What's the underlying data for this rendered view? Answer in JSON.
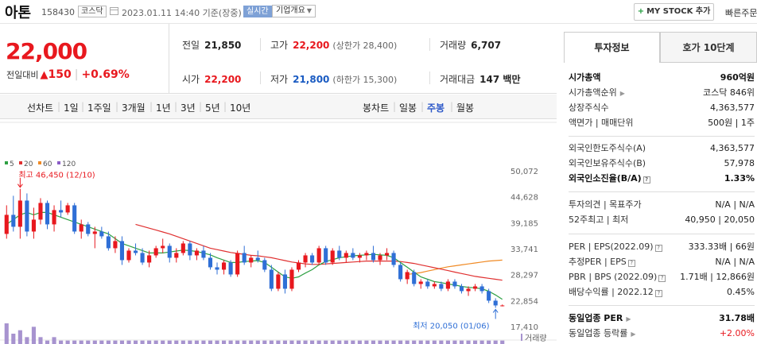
{
  "header": {
    "name": "아톤",
    "code": "158430",
    "market": "코스닥",
    "datetime": "2023.01.11 14:40 기준(장중)",
    "live_badge": "실시간",
    "overview_label": "기업개요",
    "mystock_label": "MY STOCK 추가",
    "quick_order_label": "빠른주문"
  },
  "price": {
    "current": "22,000",
    "prev_label": "전일대비",
    "change": "150",
    "change_pct": "+0.69%",
    "color_up": "#e8181e",
    "color_down": "#1a5bc2"
  },
  "stats": {
    "prev_close_label": "전일",
    "prev_close": "21,850",
    "high_label": "고가",
    "high": "22,200",
    "upper_limit_label": "(상한가 28,400)",
    "volume_label": "거래량",
    "volume": "6,707",
    "open_label": "시가",
    "open": "22,200",
    "low_label": "저가",
    "low": "21,800",
    "lower_limit_label": "(하한가 15,300)",
    "amount_label": "거래대금",
    "amount": "147 백만"
  },
  "periods": {
    "line_chart": "선차트",
    "items": [
      "1일",
      "1주일",
      "3개월",
      "1년",
      "3년",
      "5년",
      "10년"
    ],
    "candle_chart": "봉차트",
    "candle_items": [
      "일봉",
      "주봉",
      "월봉"
    ],
    "selected_candle": "주봉"
  },
  "chart_data": {
    "type": "candlestick",
    "legend": [
      {
        "name": "5",
        "color": "#2ea043"
      },
      {
        "name": "20",
        "color": "#e03030"
      },
      {
        "name": "60",
        "color": "#f08a24"
      },
      {
        "name": "120",
        "color": "#8a5cc6"
      }
    ],
    "y_ticks": [
      "50,072",
      "44,628",
      "39,185",
      "33,741",
      "28,297",
      "22,854",
      "17,410"
    ],
    "ylim": [
      17410,
      50072
    ],
    "annotations": {
      "high": "최고 46,450 (12/10)",
      "low": "최저 20,050 (01/06)"
    },
    "volume_label": "거래량",
    "candles": [
      [
        37000,
        43000,
        36000,
        41000
      ],
      [
        41000,
        45000,
        37500,
        38500
      ],
      [
        38500,
        46450,
        36000,
        44000
      ],
      [
        44000,
        45500,
        36500,
        37500
      ],
      [
        37500,
        42500,
        36000,
        40000
      ],
      [
        40000,
        44500,
        39000,
        43500
      ],
      [
        43500,
        44000,
        38000,
        39000
      ],
      [
        39000,
        43000,
        37500,
        42000
      ],
      [
        42000,
        44000,
        40500,
        41500
      ],
      [
        41500,
        43500,
        41000,
        43000
      ],
      [
        43000,
        43500,
        37000,
        37500
      ],
      [
        37500,
        40000,
        36000,
        39000
      ],
      [
        39000,
        39500,
        36500,
        37000
      ],
      [
        37000,
        38500,
        34000,
        37500
      ],
      [
        37500,
        38500,
        36000,
        36500
      ],
      [
        36500,
        37500,
        33500,
        34000
      ],
      [
        34000,
        36500,
        33000,
        35500
      ],
      [
        35500,
        36500,
        30500,
        31500
      ],
      [
        31500,
        34000,
        31000,
        33500
      ],
      [
        33500,
        35000,
        32500,
        33000
      ],
      [
        33000,
        34000,
        30500,
        31000
      ],
      [
        31000,
        33500,
        30000,
        32500
      ],
      [
        32500,
        34500,
        32000,
        34000
      ],
      [
        34000,
        36000,
        33000,
        34500
      ],
      [
        34500,
        35000,
        31000,
        32000
      ],
      [
        32000,
        34000,
        31000,
        33000
      ],
      [
        33000,
        35500,
        32500,
        35000
      ],
      [
        35000,
        35500,
        31500,
        32500
      ],
      [
        32500,
        34000,
        31500,
        33500
      ],
      [
        33500,
        34500,
        31500,
        32000
      ],
      [
        32000,
        33000,
        29500,
        30000
      ],
      [
        30000,
        31000,
        28500,
        29500
      ],
      [
        29500,
        31500,
        28500,
        31000
      ],
      [
        31000,
        31500,
        28000,
        28500
      ],
      [
        28500,
        33500,
        28000,
        33000
      ],
      [
        33000,
        34500,
        30500,
        31000
      ],
      [
        31000,
        32500,
        30000,
        32000
      ],
      [
        32000,
        33500,
        31000,
        31500
      ],
      [
        31500,
        32000,
        29000,
        29500
      ],
      [
        29500,
        30500,
        25000,
        25500
      ],
      [
        25500,
        29000,
        25000,
        28500
      ],
      [
        28500,
        29500,
        24500,
        25500
      ],
      [
        25500,
        30000,
        25000,
        29500
      ],
      [
        29500,
        31500,
        29000,
        31000
      ],
      [
        31000,
        33000,
        30000,
        32500
      ],
      [
        32500,
        33000,
        30500,
        31000
      ],
      [
        31000,
        34500,
        30500,
        34000
      ],
      [
        34000,
        34500,
        30500,
        31000
      ],
      [
        31000,
        34000,
        30500,
        33500
      ],
      [
        33500,
        34500,
        31500,
        32000
      ],
      [
        32000,
        33500,
        31000,
        33000
      ],
      [
        33000,
        34000,
        31500,
        32000
      ],
      [
        32000,
        33000,
        31000,
        32500
      ],
      [
        32500,
        33500,
        31500,
        33000
      ],
      [
        33000,
        34500,
        31000,
        31500
      ],
      [
        31500,
        33000,
        30500,
        32500
      ],
      [
        32500,
        34000,
        31500,
        33000
      ],
      [
        33000,
        33500,
        30000,
        30500
      ],
      [
        30500,
        31000,
        27000,
        27500
      ],
      [
        27500,
        29500,
        26500,
        29000
      ],
      [
        29000,
        29500,
        26000,
        26500
      ],
      [
        26500,
        27500,
        25500,
        27000
      ],
      [
        27000,
        27500,
        25500,
        26000
      ],
      [
        26000,
        27000,
        25500,
        26500
      ],
      [
        26500,
        27000,
        25000,
        25500
      ],
      [
        25500,
        27500,
        25000,
        27000
      ],
      [
        27000,
        27500,
        25500,
        26000
      ],
      [
        26000,
        26500,
        24500,
        25000
      ],
      [
        25000,
        26000,
        24000,
        25500
      ],
      [
        25500,
        26500,
        25000,
        26000
      ],
      [
        26000,
        26500,
        24500,
        25000
      ],
      [
        25000,
        25500,
        22500,
        23000
      ],
      [
        23000,
        23500,
        21500,
        22000
      ],
      [
        21850,
        22200,
        21800,
        22000
      ]
    ],
    "ma5": [
      39000,
      40000,
      41000,
      41500,
      41000,
      41500,
      41500,
      41000,
      40500,
      40000,
      39500,
      39000,
      38500,
      38000,
      37500,
      37000,
      36000,
      35000,
      34500,
      34000,
      33500,
      33000,
      33000,
      33000,
      33200,
      33400,
      33600,
      33500,
      33300,
      33000,
      32600,
      32000,
      31500,
      31000,
      31000,
      31200,
      31300,
      31400,
      31000,
      30000,
      29000,
      28000,
      27700,
      28000,
      28800,
      29500,
      30500,
      31200,
      31600,
      32000,
      32200,
      32400,
      32500,
      32600,
      32700,
      32600,
      32500,
      32000,
      31000,
      30000,
      29000,
      28000,
      27500,
      27000,
      26800,
      26500,
      26300,
      26000,
      25800,
      25700,
      25500,
      25000,
      24200,
      23300
    ],
    "ma20": [
      null,
      null,
      null,
      null,
      null,
      null,
      null,
      null,
      null,
      null,
      null,
      null,
      null,
      null,
      null,
      null,
      null,
      null,
      null,
      39000,
      38600,
      38200,
      37800,
      37400,
      37000,
      36500,
      36000,
      35500,
      35000,
      34500,
      34000,
      33700,
      33400,
      33100,
      32900,
      32700,
      32500,
      32400,
      32200,
      32000,
      31700,
      31400,
      31100,
      30900,
      30700,
      30600,
      30600,
      30700,
      30800,
      30900,
      31000,
      31100,
      31200,
      31300,
      31300,
      31300,
      31300,
      31300,
      31200,
      31000,
      30800,
      30500,
      30200,
      29900,
      29600,
      29300,
      29000,
      28700,
      28400,
      28100,
      27900,
      27700,
      27500,
      27300
    ],
    "ma60": [
      null,
      null,
      null,
      null,
      null,
      null,
      null,
      null,
      null,
      null,
      null,
      null,
      null,
      null,
      null,
      null,
      null,
      null,
      null,
      null,
      null,
      null,
      null,
      null,
      null,
      null,
      null,
      null,
      null,
      null,
      null,
      null,
      null,
      null,
      null,
      null,
      null,
      null,
      null,
      null,
      null,
      null,
      null,
      null,
      null,
      null,
      null,
      null,
      null,
      null,
      null,
      null,
      null,
      null,
      null,
      null,
      null,
      null,
      null,
      28500,
      28700,
      28900,
      29200,
      29500,
      29800,
      30100,
      30300,
      30500,
      30700,
      30900,
      31100,
      31300,
      31400,
      31500
    ],
    "ma120": [
      null,
      null,
      null,
      null,
      null,
      null,
      null,
      null,
      null,
      null,
      null,
      null,
      null,
      null,
      null,
      null,
      null,
      null,
      null,
      null,
      null,
      null,
      null,
      null,
      null,
      null,
      null,
      null,
      null,
      null,
      null,
      null,
      null,
      null,
      null,
      null,
      null,
      null,
      null,
      null,
      null,
      null,
      null,
      null,
      null,
      null,
      null,
      null,
      null,
      null,
      null,
      null,
      null,
      null,
      null,
      null,
      null,
      null,
      null,
      null,
      null,
      null,
      null,
      null,
      null,
      null,
      null,
      null,
      null,
      null,
      null,
      null,
      null,
      null
    ],
    "volumes": [
      6,
      3,
      4,
      2,
      5,
      2,
      1,
      2,
      1,
      1,
      1,
      1,
      1,
      1,
      1,
      1,
      1,
      1,
      1,
      1,
      1,
      1,
      1,
      1,
      1,
      1,
      1,
      1,
      1,
      1,
      1,
      1,
      1,
      1,
      1,
      1,
      1,
      1,
      1,
      1,
      1,
      1,
      1,
      1,
      1,
      1,
      1,
      1,
      1,
      1,
      1,
      1,
      1,
      1,
      1,
      1,
      1,
      1,
      1,
      1,
      1,
      1,
      1,
      1,
      1,
      1,
      1,
      1,
      1,
      1,
      1,
      1,
      1,
      1
    ]
  },
  "tabs": {
    "invest_info": "투자정보",
    "quote10": "호가 10단계"
  },
  "invest": {
    "market_cap_label": "시가총액",
    "market_cap": "960억원",
    "market_cap_rank_label": "시가총액순위",
    "market_cap_rank": "코스닥 846위",
    "shares_label": "상장주식수",
    "shares": "4,363,577",
    "par_label": "액면가 | 매매단위",
    "par": "500원 | 1주",
    "foreign_limit_label": "외국인한도주식수(A)",
    "foreign_limit": "4,363,577",
    "foreign_hold_label": "외국인보유주식수(B)",
    "foreign_hold": "57,978",
    "foreign_ratio_label": "외국인소진율(B/A)",
    "foreign_ratio": "1.33%",
    "opinion_label": "투자의견 | 목표주가",
    "opinion": "N/A | N/A",
    "week52_label": "52주최고 | 최저",
    "week52": "40,950 | 20,050",
    "per_label": "PER | EPS(2022.09)",
    "per": "333.33배 | 66원",
    "est_per_label": "추정PER | EPS",
    "est_per": "N/A | N/A",
    "pbr_label": "PBR | BPS (2022.09)",
    "pbr": "1.71배 | 12,866원",
    "dividend_label": "배당수익률 | 2022.12",
    "dividend": "0.45%",
    "industry_per_label": "동일업종 PER",
    "industry_per": "31.78배",
    "industry_change_label": "동일업종 등락률",
    "industry_change": "+2.00%"
  }
}
